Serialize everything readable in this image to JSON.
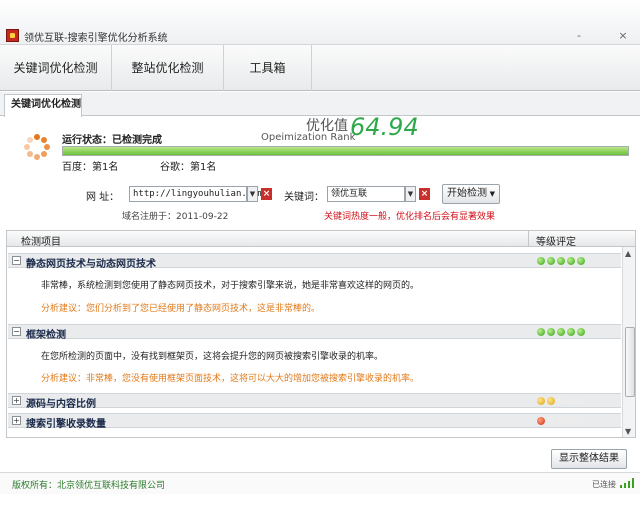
{
  "window": {
    "title": "领优互联-搜索引擎优化分析系统",
    "minimize": "-",
    "close": "×"
  },
  "topnav": [
    "关键词优化检测",
    "整站优化检测",
    "工具箱"
  ],
  "tab": "关键词优化检测",
  "status": {
    "label": "运行状态：已检测完成",
    "baidu": "百度：第1名",
    "google": "谷歌：第1名",
    "opt_label": "优化值",
    "opt_en": "Opeimization Rank",
    "opt_value": "64.94",
    "progress": 1.0
  },
  "form": {
    "url_label": "网  址：",
    "url_value": "http://lingyouhulian.com",
    "keyword_label": "关键词：",
    "keyword_value": "领优互联",
    "start_button": "开始检测",
    "domain_date": "域名注册于：2011-09-22",
    "warning": "关键词热度一般，优化排名后会有显著效果"
  },
  "list": {
    "header_item": "检测项目",
    "header_rating": "等级评定",
    "sections": [
      {
        "title": "静态网页技术与动态网页技术",
        "toggle": "−",
        "rating": [
          "g",
          "g",
          "g",
          "g",
          "g"
        ],
        "desc": "非常棒，系统检测到您使用了静态网页技术，对于搜索引擎来说，她是非常喜欢这样的网页的。",
        "advice": "分析建议：您们分析到了您已经使用了静态网页技术，这是非常棒的。"
      },
      {
        "title": "框架检测",
        "toggle": "−",
        "rating": [
          "g",
          "g",
          "g",
          "g",
          "g"
        ],
        "desc": "在您所检测的页面中，没有找到框架页，这将会提升您的网页被搜索引擎收录的机率。",
        "advice": "分析建议：非常棒，您没有使用框架页面技术，这将可以大大的增加您被搜索引擎收录的机率。"
      },
      {
        "title": "源码与内容比例",
        "toggle": "+",
        "rating": [
          "y",
          "y",
          "e",
          "e",
          "e"
        ]
      },
      {
        "title": "搜索引擎收录数量",
        "toggle": "+",
        "rating": [
          "r",
          "e",
          "e",
          "e",
          "e"
        ]
      }
    ]
  },
  "show_button": "显示整体结果",
  "footer": {
    "copyright": "版权所有：北京领优互联科技有限公司",
    "conn": "已连接"
  }
}
